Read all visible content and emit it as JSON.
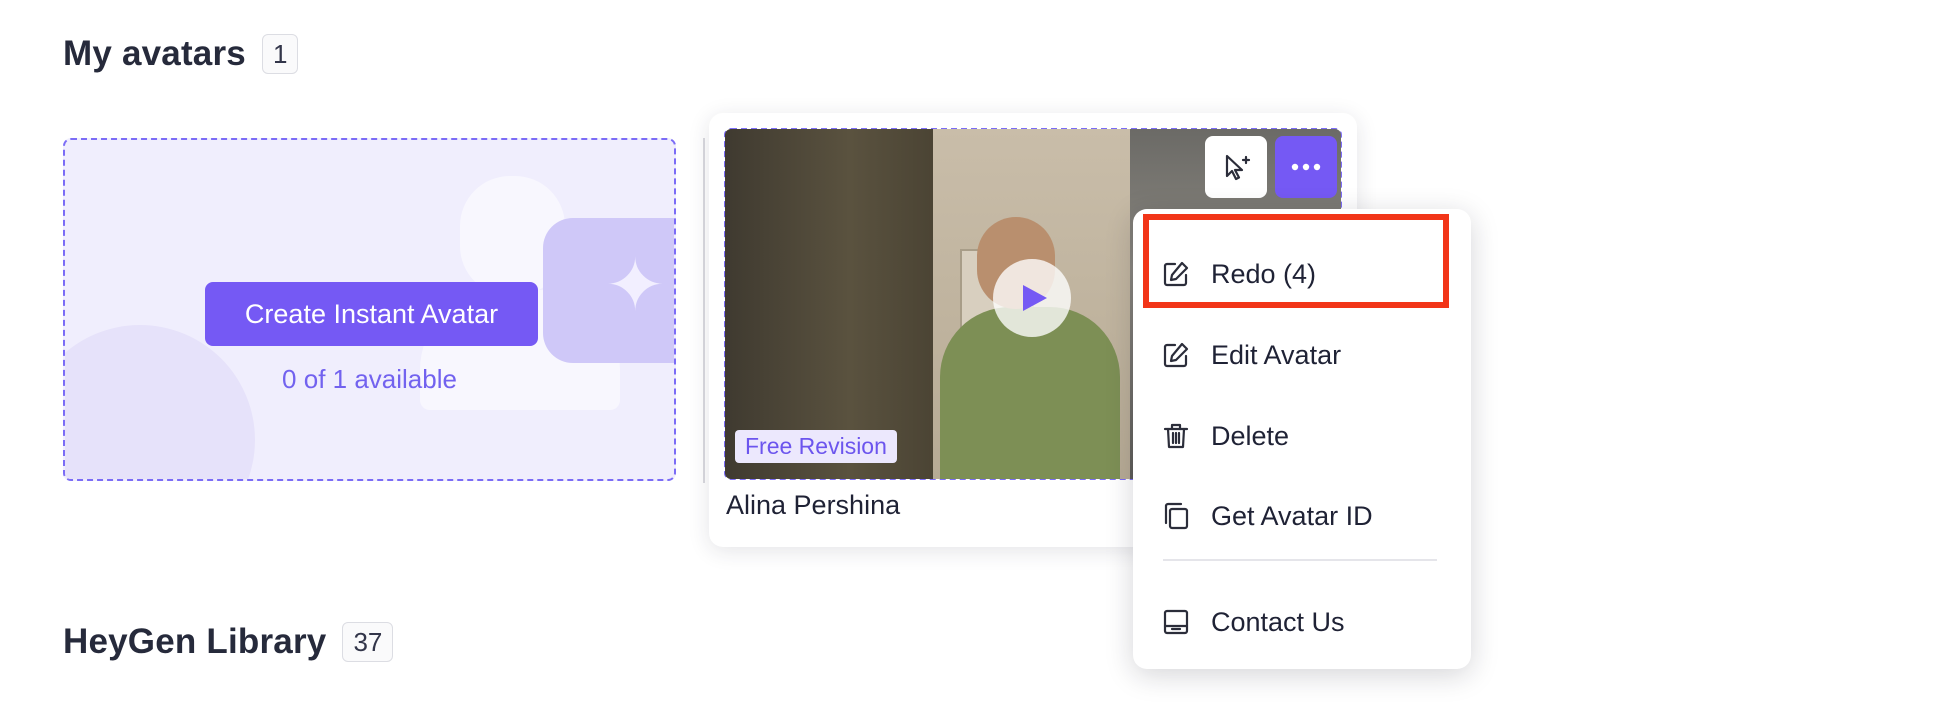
{
  "my_avatars": {
    "title": "My avatars",
    "count": "1"
  },
  "create_card": {
    "button_label": "Create Instant Avatar",
    "availability": "0 of 1 available"
  },
  "avatar": {
    "name": "Alina Pershina",
    "tag": "Free Revision"
  },
  "menu": {
    "items": [
      {
        "label": "Redo (4)",
        "icon": "edit-icon"
      },
      {
        "label": "Edit Avatar",
        "icon": "edit-icon"
      },
      {
        "label": "Delete",
        "icon": "trash-icon"
      },
      {
        "label": "Get Avatar ID",
        "icon": "copy-icon"
      },
      {
        "label": "Contact Us",
        "icon": "message-icon"
      }
    ]
  },
  "library": {
    "title": "HeyGen Library",
    "count": "37"
  },
  "colors": {
    "accent": "#7559f4",
    "highlight": "#f23518"
  }
}
